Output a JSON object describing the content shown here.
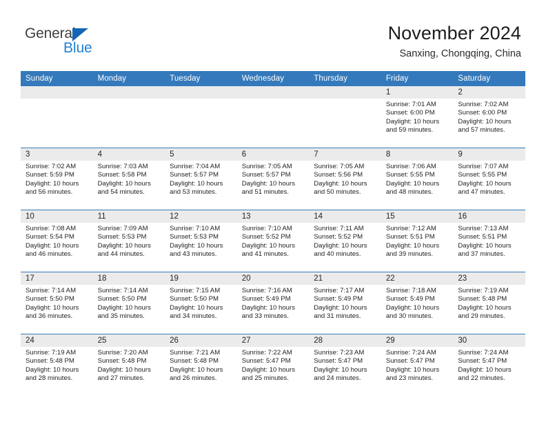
{
  "logo": {
    "word_primary": "General",
    "word_secondary": "Blue",
    "triangle_color": "#1565b5",
    "secondary_color": "#1f7fd0"
  },
  "header": {
    "title": "November 2024",
    "subtitle": "Sanxing, Chongqing, China"
  },
  "theme": {
    "header_band": "#3479bb",
    "daynum_band": "#ebebeb",
    "text": "#1f1f1f"
  },
  "weekdays": [
    "Sunday",
    "Monday",
    "Tuesday",
    "Wednesday",
    "Thursday",
    "Friday",
    "Saturday"
  ],
  "weeks": [
    [
      {
        "day": "",
        "sunrise": "",
        "sunset": "",
        "daylight": "",
        "empty": true
      },
      {
        "day": "",
        "sunrise": "",
        "sunset": "",
        "daylight": "",
        "empty": true
      },
      {
        "day": "",
        "sunrise": "",
        "sunset": "",
        "daylight": "",
        "empty": true
      },
      {
        "day": "",
        "sunrise": "",
        "sunset": "",
        "daylight": "",
        "empty": true
      },
      {
        "day": "",
        "sunrise": "",
        "sunset": "",
        "daylight": "",
        "empty": true
      },
      {
        "day": "1",
        "sunrise": "Sunrise: 7:01 AM",
        "sunset": "Sunset: 6:00 PM",
        "daylight": "Daylight: 10 hours and 59 minutes."
      },
      {
        "day": "2",
        "sunrise": "Sunrise: 7:02 AM",
        "sunset": "Sunset: 6:00 PM",
        "daylight": "Daylight: 10 hours and 57 minutes."
      }
    ],
    [
      {
        "day": "3",
        "sunrise": "Sunrise: 7:02 AM",
        "sunset": "Sunset: 5:59 PM",
        "daylight": "Daylight: 10 hours and 56 minutes."
      },
      {
        "day": "4",
        "sunrise": "Sunrise: 7:03 AM",
        "sunset": "Sunset: 5:58 PM",
        "daylight": "Daylight: 10 hours and 54 minutes."
      },
      {
        "day": "5",
        "sunrise": "Sunrise: 7:04 AM",
        "sunset": "Sunset: 5:57 PM",
        "daylight": "Daylight: 10 hours and 53 minutes."
      },
      {
        "day": "6",
        "sunrise": "Sunrise: 7:05 AM",
        "sunset": "Sunset: 5:57 PM",
        "daylight": "Daylight: 10 hours and 51 minutes."
      },
      {
        "day": "7",
        "sunrise": "Sunrise: 7:05 AM",
        "sunset": "Sunset: 5:56 PM",
        "daylight": "Daylight: 10 hours and 50 minutes."
      },
      {
        "day": "8",
        "sunrise": "Sunrise: 7:06 AM",
        "sunset": "Sunset: 5:55 PM",
        "daylight": "Daylight: 10 hours and 48 minutes."
      },
      {
        "day": "9",
        "sunrise": "Sunrise: 7:07 AM",
        "sunset": "Sunset: 5:55 PM",
        "daylight": "Daylight: 10 hours and 47 minutes."
      }
    ],
    [
      {
        "day": "10",
        "sunrise": "Sunrise: 7:08 AM",
        "sunset": "Sunset: 5:54 PM",
        "daylight": "Daylight: 10 hours and 46 minutes."
      },
      {
        "day": "11",
        "sunrise": "Sunrise: 7:09 AM",
        "sunset": "Sunset: 5:53 PM",
        "daylight": "Daylight: 10 hours and 44 minutes."
      },
      {
        "day": "12",
        "sunrise": "Sunrise: 7:10 AM",
        "sunset": "Sunset: 5:53 PM",
        "daylight": "Daylight: 10 hours and 43 minutes."
      },
      {
        "day": "13",
        "sunrise": "Sunrise: 7:10 AM",
        "sunset": "Sunset: 5:52 PM",
        "daylight": "Daylight: 10 hours and 41 minutes."
      },
      {
        "day": "14",
        "sunrise": "Sunrise: 7:11 AM",
        "sunset": "Sunset: 5:52 PM",
        "daylight": "Daylight: 10 hours and 40 minutes."
      },
      {
        "day": "15",
        "sunrise": "Sunrise: 7:12 AM",
        "sunset": "Sunset: 5:51 PM",
        "daylight": "Daylight: 10 hours and 39 minutes."
      },
      {
        "day": "16",
        "sunrise": "Sunrise: 7:13 AM",
        "sunset": "Sunset: 5:51 PM",
        "daylight": "Daylight: 10 hours and 37 minutes."
      }
    ],
    [
      {
        "day": "17",
        "sunrise": "Sunrise: 7:14 AM",
        "sunset": "Sunset: 5:50 PM",
        "daylight": "Daylight: 10 hours and 36 minutes."
      },
      {
        "day": "18",
        "sunrise": "Sunrise: 7:14 AM",
        "sunset": "Sunset: 5:50 PM",
        "daylight": "Daylight: 10 hours and 35 minutes."
      },
      {
        "day": "19",
        "sunrise": "Sunrise: 7:15 AM",
        "sunset": "Sunset: 5:50 PM",
        "daylight": "Daylight: 10 hours and 34 minutes."
      },
      {
        "day": "20",
        "sunrise": "Sunrise: 7:16 AM",
        "sunset": "Sunset: 5:49 PM",
        "daylight": "Daylight: 10 hours and 33 minutes."
      },
      {
        "day": "21",
        "sunrise": "Sunrise: 7:17 AM",
        "sunset": "Sunset: 5:49 PM",
        "daylight": "Daylight: 10 hours and 31 minutes."
      },
      {
        "day": "22",
        "sunrise": "Sunrise: 7:18 AM",
        "sunset": "Sunset: 5:49 PM",
        "daylight": "Daylight: 10 hours and 30 minutes."
      },
      {
        "day": "23",
        "sunrise": "Sunrise: 7:19 AM",
        "sunset": "Sunset: 5:48 PM",
        "daylight": "Daylight: 10 hours and 29 minutes."
      }
    ],
    [
      {
        "day": "24",
        "sunrise": "Sunrise: 7:19 AM",
        "sunset": "Sunset: 5:48 PM",
        "daylight": "Daylight: 10 hours and 28 minutes."
      },
      {
        "day": "25",
        "sunrise": "Sunrise: 7:20 AM",
        "sunset": "Sunset: 5:48 PM",
        "daylight": "Daylight: 10 hours and 27 minutes."
      },
      {
        "day": "26",
        "sunrise": "Sunrise: 7:21 AM",
        "sunset": "Sunset: 5:48 PM",
        "daylight": "Daylight: 10 hours and 26 minutes."
      },
      {
        "day": "27",
        "sunrise": "Sunrise: 7:22 AM",
        "sunset": "Sunset: 5:47 PM",
        "daylight": "Daylight: 10 hours and 25 minutes."
      },
      {
        "day": "28",
        "sunrise": "Sunrise: 7:23 AM",
        "sunset": "Sunset: 5:47 PM",
        "daylight": "Daylight: 10 hours and 24 minutes."
      },
      {
        "day": "29",
        "sunrise": "Sunrise: 7:24 AM",
        "sunset": "Sunset: 5:47 PM",
        "daylight": "Daylight: 10 hours and 23 minutes."
      },
      {
        "day": "30",
        "sunrise": "Sunrise: 7:24 AM",
        "sunset": "Sunset: 5:47 PM",
        "daylight": "Daylight: 10 hours and 22 minutes."
      }
    ]
  ]
}
